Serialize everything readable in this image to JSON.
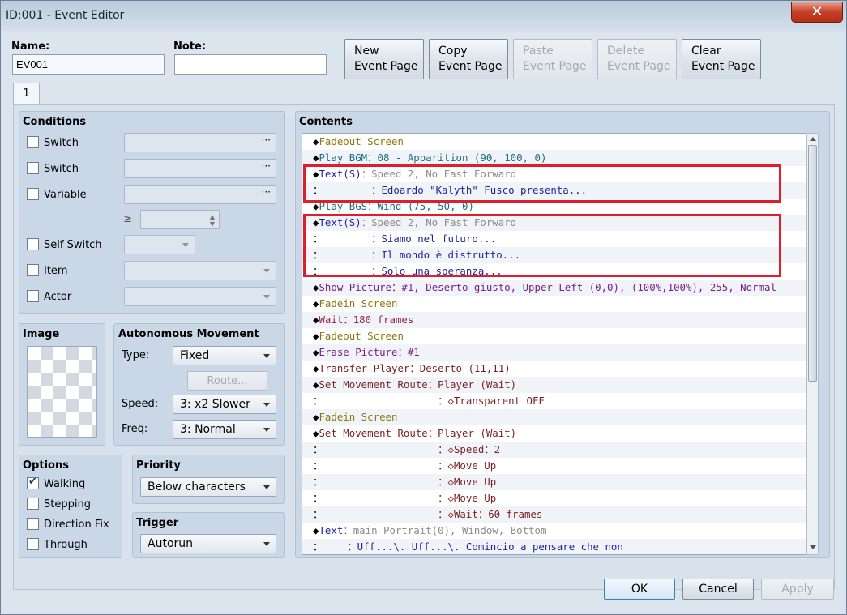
{
  "window": {
    "title": "ID:001 - Event Editor",
    "close_glyph": "✕"
  },
  "header": {
    "name_label": "Name:",
    "name_value": "EV001",
    "note_label": "Note:",
    "note_value": "",
    "buttons": {
      "new": [
        "New",
        "Event Page"
      ],
      "copy": [
        "Copy",
        "Event Page"
      ],
      "paste": [
        "Paste",
        "Event Page"
      ],
      "delete": [
        "Delete",
        "Event Page"
      ],
      "clear": [
        "Clear",
        "Event Page"
      ]
    }
  },
  "tabs": [
    "1"
  ],
  "conditions": {
    "title": "Conditions",
    "switch1": "Switch",
    "switch2": "Switch",
    "variable": "Variable",
    "gte": "≥",
    "self_switch": "Self Switch",
    "item": "Item",
    "actor": "Actor",
    "dots": "···"
  },
  "image": {
    "title": "Image"
  },
  "autonomous": {
    "title": "Autonomous Movement",
    "type_label": "Type:",
    "type_value": "Fixed",
    "route_button": "Route...",
    "speed_label": "Speed:",
    "speed_value": "3: x2 Slower",
    "freq_label": "Freq:",
    "freq_value": "3: Normal"
  },
  "options": {
    "title": "Options",
    "walking": "Walking",
    "walking_checked": true,
    "stepping": "Stepping",
    "direction_fix": "Direction Fix",
    "through": "Through"
  },
  "priority": {
    "title": "Priority",
    "value": "Below characters"
  },
  "trigger": {
    "title": "Trigger",
    "value": "Autorun"
  },
  "contents": {
    "title": "Contents",
    "rows": [
      {
        "head": "◆Fadeout Screen",
        "body": "",
        "cls": "cmd-fade"
      },
      {
        "head": "◆Play BGM",
        "body": "：08 - Apparition (90, 100, 0)",
        "cls": "cmd-bgm"
      },
      {
        "head": "◆Text(S)",
        "body": "：Speed 2, No Fast Forward",
        "cls": "cmd-text",
        "grey": true
      },
      {
        "head": "：",
        "body": "        ：Edoardo \"Kalyth\" Fusco presenta...",
        "cls": "cmd-text"
      },
      {
        "head": "◆Play BGS",
        "body": "：Wind (75, 50, 0)",
        "cls": "cmd-bgm"
      },
      {
        "head": "◆Text(S)",
        "body": "：Speed 2, No Fast Forward",
        "cls": "cmd-text",
        "grey": true
      },
      {
        "head": "：",
        "body": "        ：Siamo nel futuro...",
        "cls": "cmd-text"
      },
      {
        "head": "：",
        "body": "        ：Il mondo è distrutto...",
        "cls": "cmd-text"
      },
      {
        "head": "：",
        "body": "        ：Solo una speranza...",
        "cls": "cmd-text"
      },
      {
        "head": "◆Show Picture",
        "body": "：#1, Deserto_giusto, Upper Left (0,0), (100%,100%), 255, Normal",
        "cls": "cmd-pic"
      },
      {
        "head": "◆Fadein Screen",
        "body": "",
        "cls": "cmd-fade"
      },
      {
        "head": "◆Wait",
        "body": "：180 frames",
        "cls": "cmd-wait"
      },
      {
        "head": "◆Fadeout Screen",
        "body": "",
        "cls": "cmd-fade"
      },
      {
        "head": "◆Erase Picture",
        "body": "：#1",
        "cls": "cmd-pic"
      },
      {
        "head": "◆Transfer Player",
        "body": "：Deserto (11,11)",
        "cls": "cmd-move"
      },
      {
        "head": "◆Set Movement Route",
        "body": "：Player (Wait)",
        "cls": "cmd-move"
      },
      {
        "head": "：",
        "body": "                   ：◇Transparent OFF",
        "cls": "cmd-move"
      },
      {
        "head": "◆Fadein Screen",
        "body": "",
        "cls": "cmd-fade"
      },
      {
        "head": "◆Set Movement Route",
        "body": "：Player (Wait)",
        "cls": "cmd-move"
      },
      {
        "head": "：",
        "body": "                   ：◇Speed：2",
        "cls": "cmd-move"
      },
      {
        "head": "：",
        "body": "                   ：◇Move Up",
        "cls": "cmd-move"
      },
      {
        "head": "：",
        "body": "                   ：◇Move Up",
        "cls": "cmd-move"
      },
      {
        "head": "：",
        "body": "                   ：◇Move Up",
        "cls": "cmd-move"
      },
      {
        "head": "：",
        "body": "                   ：◇Wait：60 frames",
        "cls": "cmd-move"
      },
      {
        "head": "◆Text",
        "body": "：main_Portrait(0), Window, Bottom",
        "cls": "cmd-text",
        "grey": true
      },
      {
        "head": "：",
        "body": "    ：Uff...\\. Uff...\\. Comincio a pensare che non",
        "cls": "cmd-text"
      }
    ]
  },
  "footer": {
    "ok": "OK",
    "cancel": "Cancel",
    "apply": "Apply"
  },
  "colors": {
    "highlight_box": "#e21d2b"
  }
}
